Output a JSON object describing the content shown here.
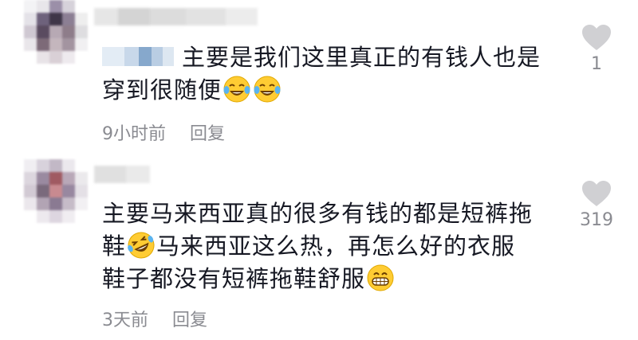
{
  "comments": [
    {
      "text_line1": "主要是我们这里真正的有钱人也是",
      "text_line2": "穿到很随便",
      "emojis": [
        "laugh-cry-emoji",
        "laugh-cry-emoji"
      ],
      "time": "9小时前",
      "reply_label": "回复",
      "likes": "1"
    },
    {
      "text_line1": "主要马来西亚真的很多有钱的都是短裤拖",
      "text_line2_a": "鞋",
      "text_line2_b": "马来西亚这么热，再怎么好的衣服",
      "text_line3": "鞋子都没有短裤拖鞋舒服",
      "emojis": [
        "rofl-emoji",
        "grin-emoji"
      ],
      "time": "3天前",
      "reply_label": "回复",
      "likes": "319"
    }
  ],
  "colors": {
    "text": "#161823",
    "meta": "#8a8b91",
    "heart": "#d0d0d3"
  }
}
